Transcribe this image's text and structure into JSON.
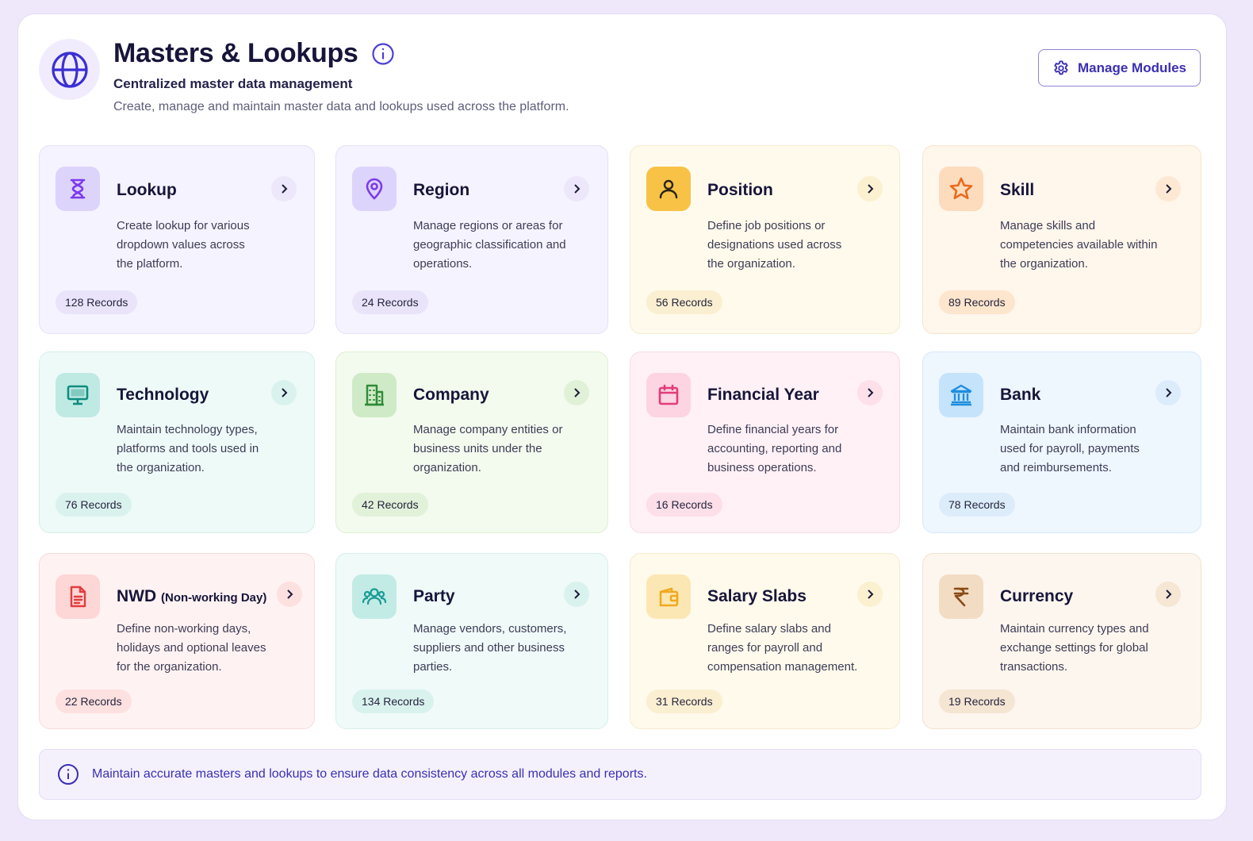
{
  "header": {
    "title": "Masters & Lookups",
    "subtitle": "Centralized master data management",
    "description": "Create, manage and maintain master data and lookups used across the platform.",
    "manage_button": "Manage Modules"
  },
  "cards": [
    {
      "title": "Lookup",
      "title_sub": "",
      "description": "Create lookup for various dropdown values across the platform.",
      "records": "128 Records",
      "icon": "hourglass-icon",
      "accent": "#7c3aed"
    },
    {
      "title": "Region",
      "title_sub": "",
      "description": "Manage regions or areas for geographic classification and operations.",
      "records": "24 Records",
      "icon": "map-pin-icon",
      "accent": "#7c3aed"
    },
    {
      "title": "Position",
      "title_sub": "",
      "description": "Define job positions or designations used across the organization.",
      "records": "56 Records",
      "icon": "user-icon",
      "accent": "#f5b82e"
    },
    {
      "title": "Skill",
      "title_sub": "",
      "description": "Manage skills and competencies available within the organization.",
      "records": "89 Records",
      "icon": "star-icon",
      "accent": "#ea6b1e"
    },
    {
      "title": "Technology",
      "title_sub": "",
      "description": "Maintain technology types, platforms and tools used in the organization.",
      "records": "76 Records",
      "icon": "monitor-icon",
      "accent": "#0f9c8f"
    },
    {
      "title": "Company",
      "title_sub": "",
      "description": "Manage company entities or business units under the organization.",
      "records": "42 Records",
      "icon": "building-icon",
      "accent": "#2e9b3e"
    },
    {
      "title": "Financial Year",
      "title_sub": "",
      "description": "Define financial years for accounting, reporting and business operations.",
      "records": "16 Records",
      "icon": "calendar-icon",
      "accent": "#e23c7a"
    },
    {
      "title": "Bank",
      "title_sub": "",
      "description": "Maintain bank information used for payroll, payments and reimbursements.",
      "records": "78 Records",
      "icon": "bank-icon",
      "accent": "#1f8ee0"
    },
    {
      "title": "NWD",
      "title_sub": "(Non-working Day)",
      "description": "Define non-working days, holidays and optional leaves for the organization.",
      "records": "22 Records",
      "icon": "document-icon",
      "accent": "#e23c3c"
    },
    {
      "title": "Party",
      "title_sub": "",
      "description": "Manage vendors, customers, suppliers and other business parties.",
      "records": "134 Records",
      "icon": "users-icon",
      "accent": "#1a9c95"
    },
    {
      "title": "Salary Slabs",
      "title_sub": "",
      "description": "Define salary slabs and ranges for payroll and compensation management.",
      "records": "31 Records",
      "icon": "wallet-icon",
      "accent": "#f5b82e"
    },
    {
      "title": "Currency",
      "title_sub": "",
      "description": "Maintain currency types and exchange settings for global transactions.",
      "records": "19 Records",
      "icon": "rupee-icon",
      "accent": "#8a4b16"
    }
  ],
  "footer": {
    "note": "Maintain accurate masters and lookups to ensure data consistency across all modules and reports."
  }
}
